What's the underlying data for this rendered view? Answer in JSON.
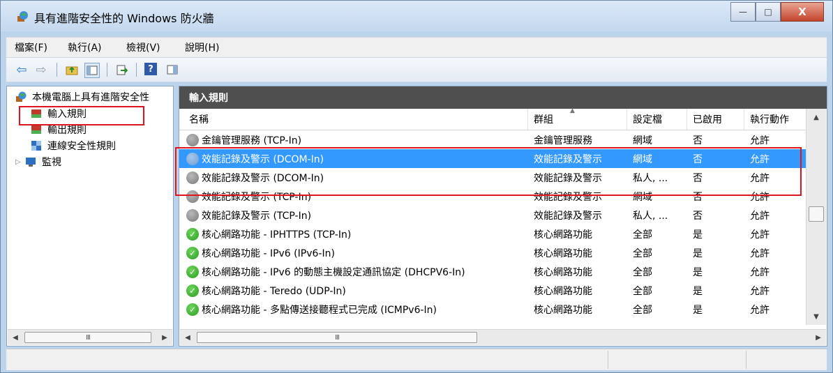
{
  "window": {
    "title": "具有進階安全性的 Windows 防火牆",
    "minimize_label": "—",
    "maximize_label": "□",
    "close_label": "X"
  },
  "menubar": {
    "items": [
      "檔案(F)",
      "執行(A)",
      "檢視(V)",
      "說明(H)"
    ]
  },
  "toolbar": {
    "icons": [
      "back-arrow-icon",
      "forward-arrow-icon",
      "up-folder-icon",
      "show-hide-console-tree-icon",
      "export-list-icon",
      "help-icon",
      "action-pane-icon"
    ]
  },
  "tree": {
    "root": "本機電腦上具有進階安全性",
    "items": [
      {
        "label": "輸入規則",
        "selected": true
      },
      {
        "label": "輸出規則"
      },
      {
        "label": "連線安全性規則"
      },
      {
        "label": "監視",
        "expander": "▷"
      }
    ]
  },
  "pane": {
    "title": "輸入規則"
  },
  "table": {
    "columns": [
      "名稱",
      "群組",
      "設定檔",
      "已啟用",
      "執行動作"
    ],
    "sort_indicator": "▲",
    "rows": [
      {
        "name": "金鑰管理服務 (TCP-In)",
        "group": "金鑰管理服務",
        "profile": "網域",
        "enabled": "否",
        "action": "允許",
        "status": "disabled"
      },
      {
        "name": "效能記錄及警示 (DCOM-In)",
        "group": "效能記錄及警示",
        "profile": "網域",
        "enabled": "否",
        "action": "允許",
        "status": "disabled",
        "selected": true
      },
      {
        "name": "效能記錄及警示 (DCOM-In)",
        "group": "效能記錄及警示",
        "profile": "私人, ...",
        "enabled": "否",
        "action": "允許",
        "status": "disabled"
      },
      {
        "name": "效能記錄及警示 (TCP-In)",
        "group": "效能記錄及警示",
        "profile": "網域",
        "enabled": "否",
        "action": "允許",
        "status": "disabled"
      },
      {
        "name": "效能記錄及警示 (TCP-In)",
        "group": "效能記錄及警示",
        "profile": "私人, ...",
        "enabled": "否",
        "action": "允許",
        "status": "disabled"
      },
      {
        "name": "核心網路功能 - IPHTTPS (TCP-In)",
        "group": "核心網路功能",
        "profile": "全部",
        "enabled": "是",
        "action": "允許",
        "status": "enabled"
      },
      {
        "name": "核心網路功能 - IPv6 (IPv6-In)",
        "group": "核心網路功能",
        "profile": "全部",
        "enabled": "是",
        "action": "允許",
        "status": "enabled"
      },
      {
        "name": "核心網路功能 - IPv6 的動態主機設定通訊協定 (DHCPV6-In)",
        "group": "核心網路功能",
        "profile": "全部",
        "enabled": "是",
        "action": "允許",
        "status": "enabled"
      },
      {
        "name": "核心網路功能 - Teredo (UDP-In)",
        "group": "核心網路功能",
        "profile": "全部",
        "enabled": "是",
        "action": "允許",
        "status": "enabled"
      },
      {
        "name": "核心網路功能 - 多點傳送接聽程式已完成 (ICMPv6-In)",
        "group": "核心網路功能",
        "profile": "全部",
        "enabled": "是",
        "action": "允許",
        "status": "enabled"
      }
    ]
  },
  "scrollbar": {
    "thumb_grip": "III",
    "left_arrow": "◀",
    "right_arrow": "▶",
    "up_arrow": "▲",
    "down_arrow": "▼"
  },
  "colors": {
    "selection": "#3399ff",
    "header_bar": "#4f4f4f",
    "highlight_box": "#e0141e",
    "enabled_icon": "#2c9a21",
    "disabled_icon": "#7a7a7a"
  }
}
